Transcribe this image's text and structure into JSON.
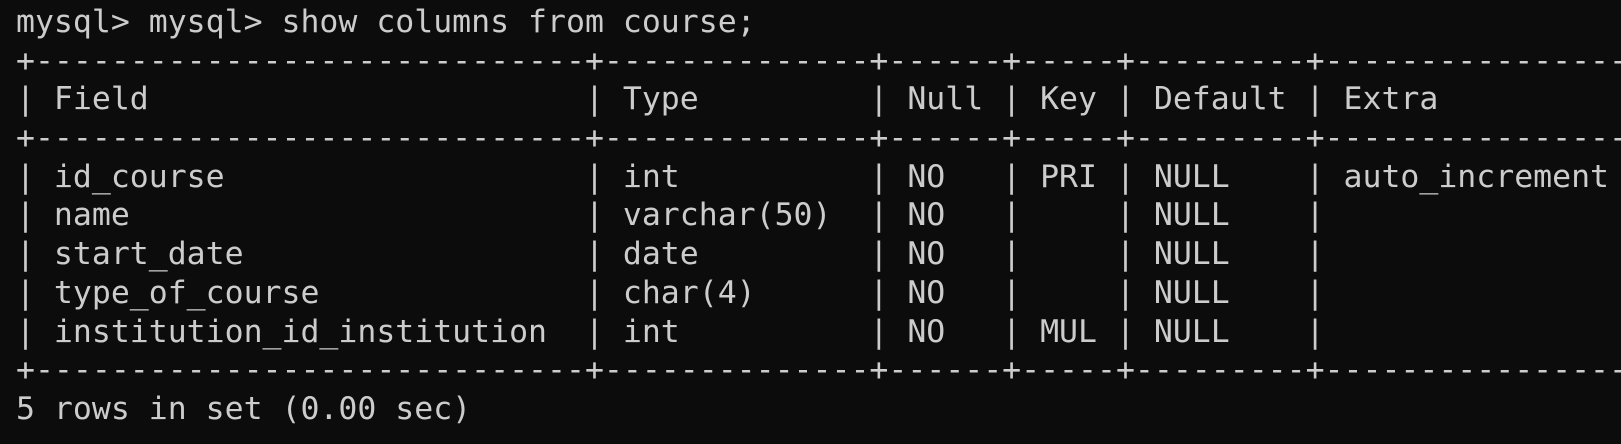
{
  "terminal": {
    "prompt_line": "mysql> mysql> show columns from course;",
    "table_border": "+-----------------------------+--------------+------+-----+---------+----------------+",
    "header_row": "| Field                       | Type         | Null | Key | Default | Extra          |",
    "rows": [
      "| id_course                   | int          | NO   | PRI | NULL    | auto_increment |",
      "| name                        | varchar(50)  | NO   |     | NULL    |                |",
      "| start_date                  | date         | NO   |     | NULL    |                |",
      "| type_of_course              | char(4)      | NO   |     | NULL    |                |",
      "| institution_id_institution  | int          | NO   | MUL | NULL    |                |"
    ],
    "result_line": "5 rows in set (0.00 sec)"
  },
  "colors": {
    "background": "#0c0c0c",
    "text": "#cccccc"
  }
}
